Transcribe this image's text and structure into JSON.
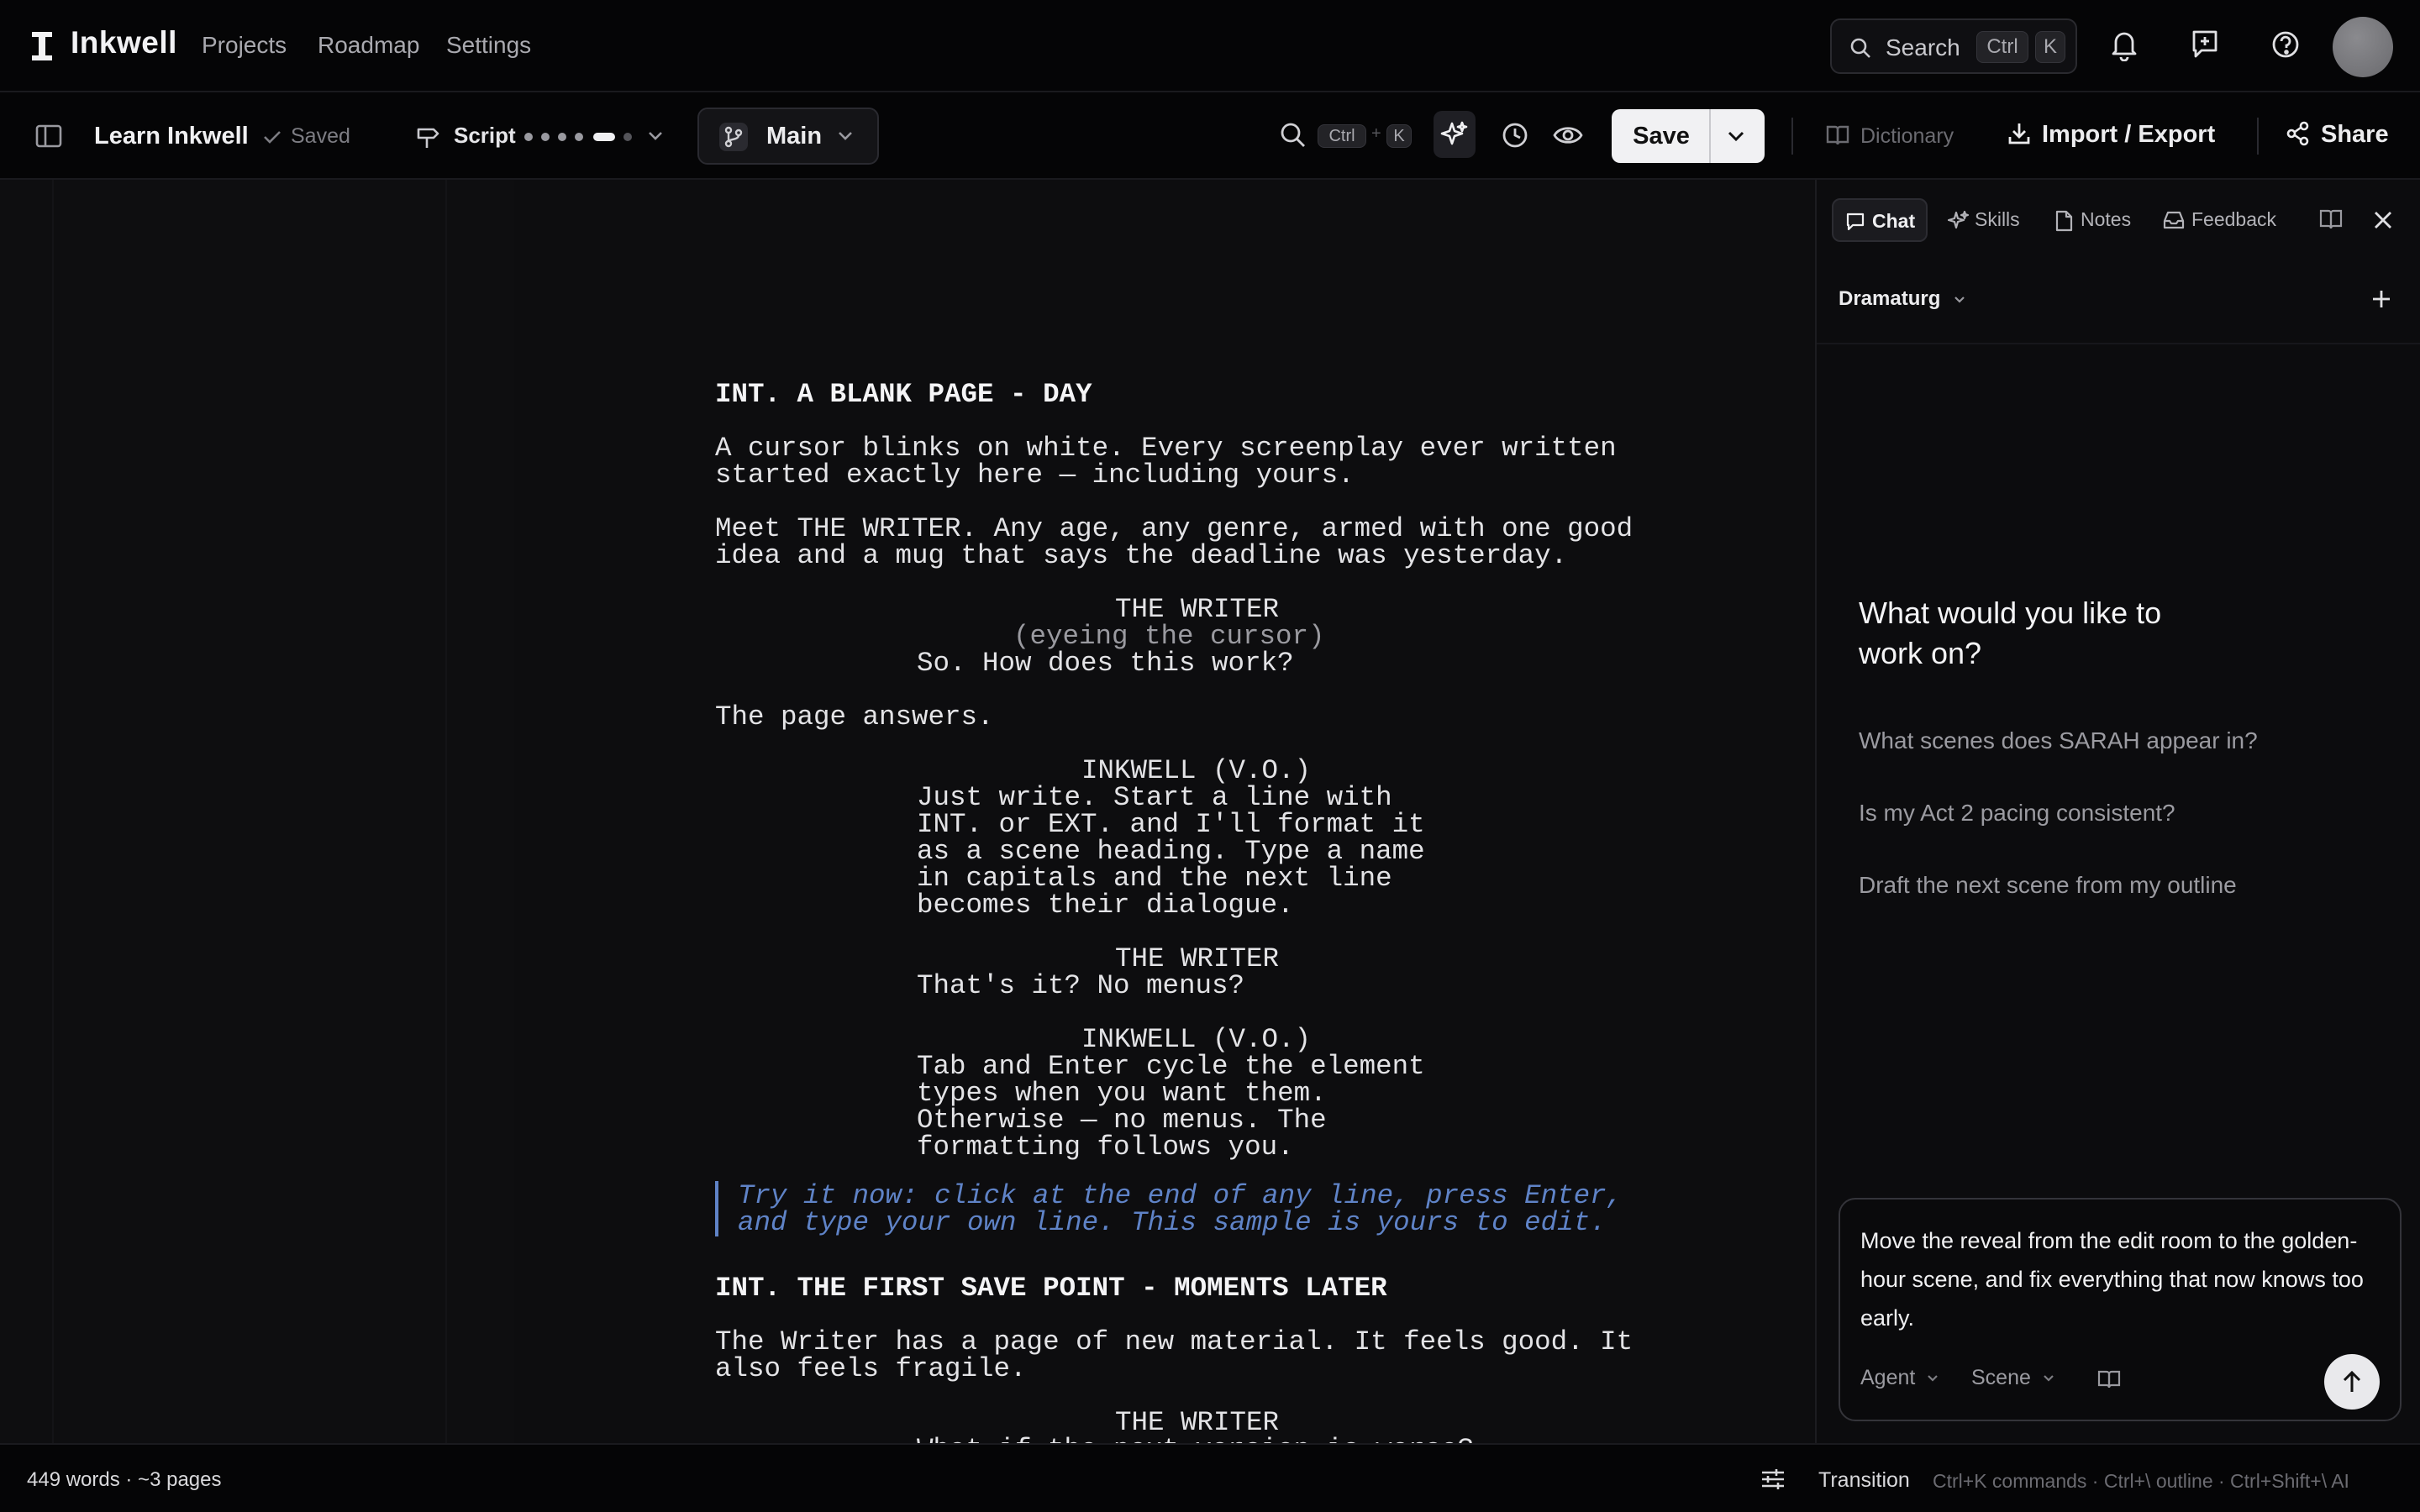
{
  "app": {
    "name": "Inkwell"
  },
  "nav": {
    "items": [
      "Projects",
      "Roadmap",
      "Settings"
    ]
  },
  "search": {
    "label": "Search",
    "kbd1": "Ctrl",
    "kbd2": "K"
  },
  "toolbar": {
    "doc_title": "Learn Inkwell",
    "saved_status": "Saved",
    "mode_label": "Script",
    "branch_label": "Main",
    "find_kbd1": "Ctrl",
    "find_plus": "+",
    "find_kbd2": "K",
    "save_label": "Save",
    "dictionary_label": "Dictionary",
    "import_export_label": "Import / Export",
    "share_label": "Share"
  },
  "script": {
    "lines": [
      {
        "type": "scene",
        "text": "INT. A BLANK PAGE - DAY"
      },
      {
        "type": "action",
        "text": "A cursor blinks on white. Every screenplay ever written\nstarted exactly here — including yours."
      },
      {
        "type": "action",
        "text": "Meet THE WRITER. Any age, any genre, armed with one good\nidea and a mug that says the deadline was yesterday."
      },
      {
        "type": "character",
        "text": "THE WRITER"
      },
      {
        "type": "parenthetical",
        "text": "(eyeing the cursor)"
      },
      {
        "type": "dialogue",
        "text": "So. How does this work?"
      },
      {
        "type": "action",
        "text": "The page answers."
      },
      {
        "type": "character",
        "text": "INKWELL (V.O.)"
      },
      {
        "type": "dialogue",
        "text": "Just write. Start a line with\nINT. or EXT. and I'll format it\nas a scene heading. Type a name\nin capitals and the next line\nbecomes their dialogue."
      },
      {
        "type": "character",
        "text": "THE WRITER"
      },
      {
        "type": "dialogue",
        "text": "That's it? No menus?"
      },
      {
        "type": "character",
        "text": "INKWELL (V.O.)"
      },
      {
        "type": "dialogue",
        "text": "Tab and Enter cycle the element\ntypes when you want them.\nOtherwise — no menus. The\nformatting follows you."
      },
      {
        "type": "hint",
        "text": "Try it now: click at the end of any line, press Enter,\nand type your own line. This sample is yours to edit."
      },
      {
        "type": "scene",
        "text": "INT. THE FIRST SAVE POINT - MOMENTS LATER"
      },
      {
        "type": "action",
        "text": "The Writer has a page of new material. It feels good. It\nalso feels fragile."
      },
      {
        "type": "character",
        "text": "THE WRITER"
      },
      {
        "type": "dialogue",
        "text": "What if the next version is worse?"
      }
    ]
  },
  "panel": {
    "tabs": [
      "Chat",
      "Skills",
      "Notes",
      "Feedback"
    ],
    "assistant_label": "Dramaturg",
    "welcome": "What would you like to work on?",
    "suggestions": [
      "What scenes does SARAH appear in?",
      "Is my Act 2 pacing consistent?",
      "Draft the next scene from my outline"
    ],
    "composer_text": "Move the reveal from the edit room to the golden-hour scene, and fix everything that now knows too early.",
    "mode_option": "Agent",
    "scope_option": "Scene"
  },
  "status": {
    "word_count": "449 words · ~3 pages",
    "element_type": "Transition",
    "shortcuts": "Ctrl+K commands · Ctrl+\\ outline · Ctrl+Shift+\\ AI"
  },
  "colors": {
    "accent_hint": "#5f83c7",
    "background": "#0c0c0e",
    "save_button": "#f1f1f3"
  },
  "icons": [
    "search-icon",
    "bell-icon",
    "message-plus-icon",
    "help-icon",
    "sidebar-toggle-icon",
    "check-icon",
    "signpost-icon",
    "branch-icon",
    "sparkle-icon",
    "history-icon",
    "eye-icon",
    "chevron-down-icon",
    "book-icon",
    "download-icon",
    "share-icon",
    "chat-icon",
    "notes-icon",
    "inbox-icon",
    "close-icon",
    "plus-icon",
    "arrow-up-icon",
    "sliders-icon"
  ]
}
